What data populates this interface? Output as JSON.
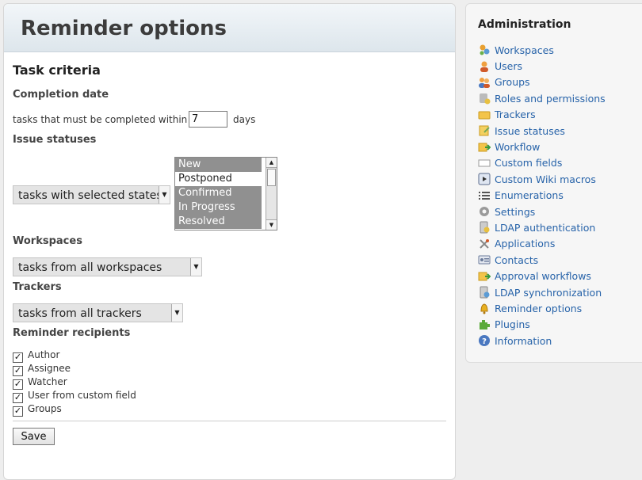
{
  "page": {
    "title": "Reminder options"
  },
  "task_criteria": {
    "heading": "Task criteria",
    "completion": {
      "heading": "Completion date",
      "prefix": "tasks that must be completed within",
      "value": "7",
      "suffix": "days"
    },
    "issue_statuses": {
      "heading": "Issue statuses",
      "mode_selected": "tasks with selected states",
      "options": [
        {
          "label": "New",
          "selected": true
        },
        {
          "label": "Postponed",
          "selected": false
        },
        {
          "label": "Confirmed",
          "selected": true
        },
        {
          "label": "In Progress",
          "selected": true
        },
        {
          "label": "Resolved",
          "selected": true
        }
      ]
    },
    "workspaces": {
      "heading": "Workspaces",
      "selected": "tasks from all workspaces"
    },
    "trackers": {
      "heading": "Trackers",
      "selected": "tasks from all trackers"
    },
    "recipients": {
      "heading": "Reminder recipients",
      "items": [
        {
          "label": "Author",
          "checked": true
        },
        {
          "label": "Assignee",
          "checked": true
        },
        {
          "label": "Watcher",
          "checked": true
        },
        {
          "label": "User from custom field",
          "checked": true
        },
        {
          "label": "Groups",
          "checked": true
        }
      ]
    },
    "save_label": "Save"
  },
  "sidebar": {
    "heading": "Administration",
    "items": [
      {
        "label": "Workspaces",
        "icon": "workspaces-icon"
      },
      {
        "label": "Users",
        "icon": "user-icon"
      },
      {
        "label": "Groups",
        "icon": "group-icon"
      },
      {
        "label": "Roles and permissions",
        "icon": "roles-icon"
      },
      {
        "label": "Trackers",
        "icon": "tracker-icon"
      },
      {
        "label": "Issue statuses",
        "icon": "issue-status-icon"
      },
      {
        "label": "Workflow",
        "icon": "workflow-icon"
      },
      {
        "label": "Custom fields",
        "icon": "custom-field-icon"
      },
      {
        "label": "Custom Wiki macros",
        "icon": "wiki-macro-icon"
      },
      {
        "label": "Enumerations",
        "icon": "list-icon"
      },
      {
        "label": "Settings",
        "icon": "gear-icon"
      },
      {
        "label": "LDAP authentication",
        "icon": "ldap-icon"
      },
      {
        "label": "Applications",
        "icon": "applications-icon"
      },
      {
        "label": "Contacts",
        "icon": "contacts-icon"
      },
      {
        "label": "Approval workflows",
        "icon": "approval-icon"
      },
      {
        "label": "LDAP synchronization",
        "icon": "ldap-sync-icon"
      },
      {
        "label": "Reminder options",
        "icon": "bell-icon"
      },
      {
        "label": "Plugins",
        "icon": "plugin-icon"
      },
      {
        "label": "Information",
        "icon": "info-icon"
      }
    ]
  },
  "colors": {
    "link": "#2763a9",
    "selected_option": "#909090"
  }
}
